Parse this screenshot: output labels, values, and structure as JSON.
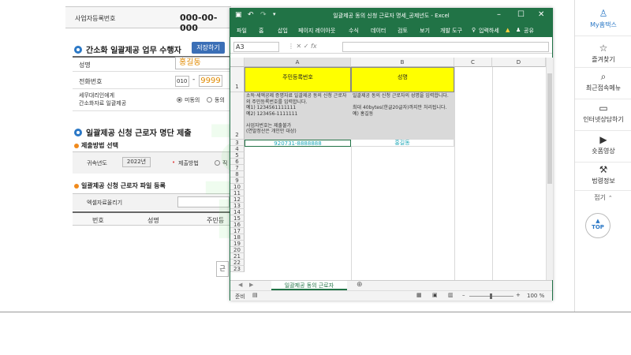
{
  "form": {
    "biz_reg_label": "사업자등록번호",
    "biz_reg_value": "000-00-000",
    "section1_title": "간소화 일괄제공 업무 수행자",
    "save_button": "저장하기",
    "name_label": "성명",
    "name_value": "홍길동",
    "phone_label": "전화번호",
    "phone_prefix": "010",
    "phone_dash": "-",
    "phone_mid": "9999",
    "consent_label_1": "세무대리인에게",
    "consent_label_2": "간소화자료 일괄제공",
    "consent_opt1": "미동의",
    "consent_opt2": "동의",
    "section2_title": "일괄제공 신청 근로자 명단 제출",
    "submit_method_title": "제출방법 선택",
    "year_label": "귀속년도",
    "year_value": "2022년",
    "submit_method_label": "제출방법",
    "submit_opt": "직",
    "file_reg_title": "일괄제공 신청 근로자 파일 등록",
    "file_label": "엑셀자료올리기",
    "col_no": "번호",
    "col_name": "성명",
    "col_rrn": "주민등",
    "bottom_btn": "근"
  },
  "excel": {
    "title": "일괄제공 동의 신청 근로자 명세_공제년도 - Excel",
    "ribbon_tabs": [
      "파일",
      "홈",
      "삽입",
      "페이지 레이아웃",
      "수식",
      "데이터",
      "검토",
      "보기",
      "개발 도구"
    ],
    "tell_me": "입력하세",
    "share": "공유",
    "name_box": "A3",
    "col_headers": [
      "A",
      "B",
      "C",
      "D"
    ],
    "row_numbers": [
      "1",
      "2",
      "3",
      "4",
      "5",
      "6",
      "7",
      "8",
      "9",
      "10",
      "11",
      "12",
      "13",
      "14",
      "15",
      "16",
      "17",
      "18",
      "19",
      "20",
      "21",
      "22",
      "23"
    ],
    "a1": "주민등록번호",
    "b1": "성명",
    "a2": "소득·세액공제 증명자료 일괄제공 동의 신청 근로자의 주민등록번호를 입력합니다.\n예1) 1234561111111\n예2) 123456-1111111\n\n사업자번호는 제출불가\n(연말정산은 개인만 대상)",
    "b2": "일괄제공 동의 신청 근로자의 성명을 입력합니다.\n\n최대 40bytes(한글20글자)까지만 처리됩니다.\n예) 홍길동",
    "a3": "920731-8888888",
    "b3": "홍길동",
    "sheet_tab": "일괄제공 동의 근로자",
    "status_ready": "준비",
    "zoom": "100 %"
  },
  "sidebar": {
    "items": [
      {
        "label": "My홈택스",
        "icon": "person-icon"
      },
      {
        "label": "즐겨찾기",
        "icon": "star-icon"
      },
      {
        "label": "최근접속메뉴",
        "icon": "history-icon"
      },
      {
        "label": "인터넷상담하기",
        "icon": "monitor-icon"
      },
      {
        "label": "숏폼영상",
        "icon": "play-icon"
      },
      {
        "label": "법령정보",
        "icon": "gavel-icon"
      }
    ],
    "collapse": "접기",
    "top": "TOP"
  },
  "watermark": "홈택"
}
